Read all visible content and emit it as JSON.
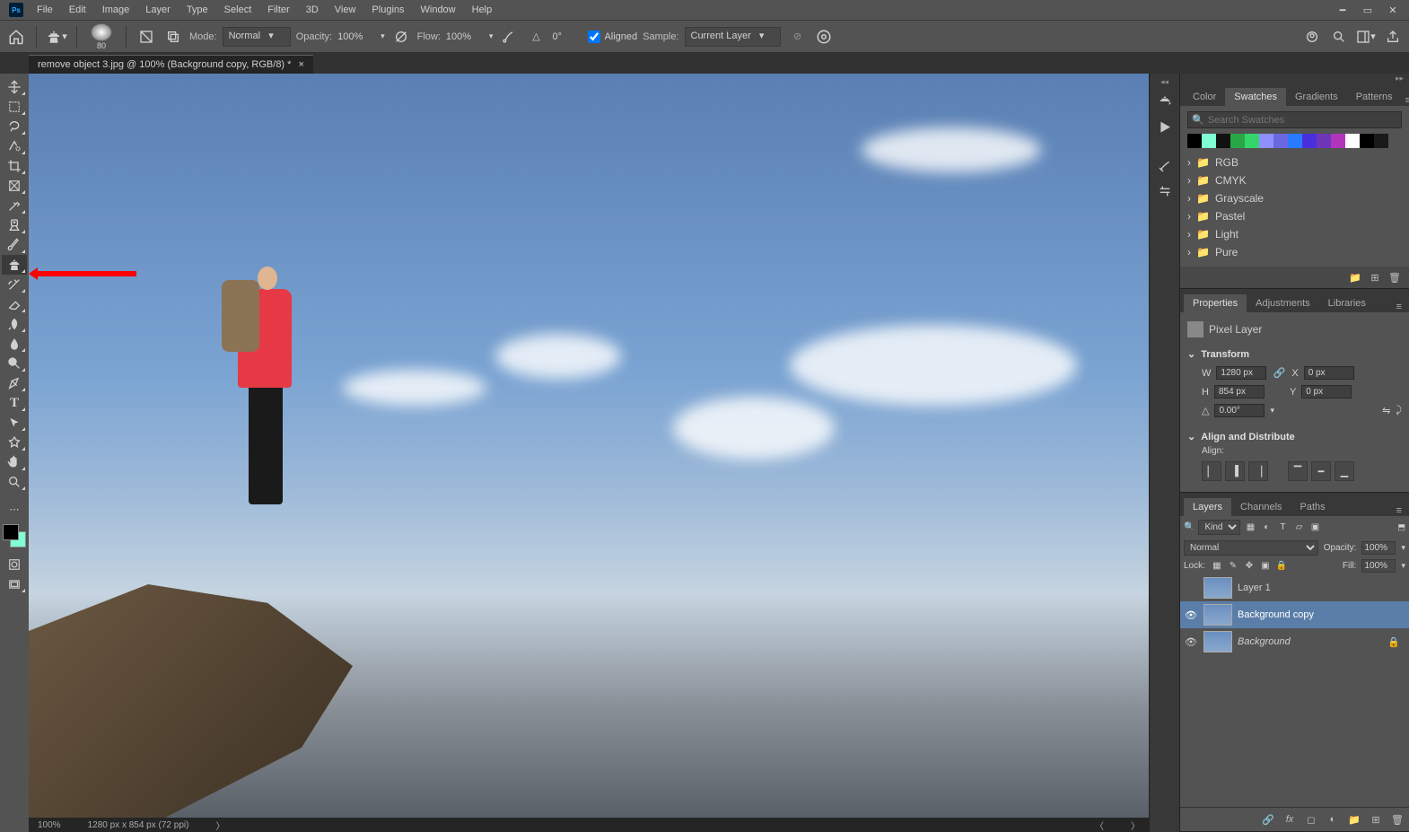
{
  "menu": {
    "items": [
      "File",
      "Edit",
      "Image",
      "Layer",
      "Type",
      "Select",
      "Filter",
      "3D",
      "View",
      "Plugins",
      "Window",
      "Help"
    ]
  },
  "options": {
    "brush_size": "80",
    "mode_label": "Mode:",
    "mode_value": "Normal",
    "opacity_label": "Opacity:",
    "opacity_value": "100%",
    "flow_label": "Flow:",
    "flow_value": "100%",
    "angle_value": "0°",
    "aligned_label": "Aligned",
    "sample_label": "Sample:",
    "sample_value": "Current Layer"
  },
  "doc": {
    "title": "remove object 3.jpg @ 100% (Background copy, RGB/8) *"
  },
  "swatches": {
    "tabs": [
      "Color",
      "Swatches",
      "Gradients",
      "Patterns"
    ],
    "active_tab": 1,
    "search_placeholder": "Search Swatches",
    "colors_row": [
      "#000000",
      "#7fffd4",
      "#111111",
      "#2aa745",
      "#35d56a",
      "#8f8fff",
      "#6a68e0",
      "#2a7aff",
      "#4a2fdf",
      "#6e36b8",
      "#b035bb",
      "#ffffff",
      "#000000",
      "#1a1a1a"
    ],
    "folders": [
      "RGB",
      "CMYK",
      "Grayscale",
      "Pastel",
      "Light",
      "Pure"
    ]
  },
  "properties": {
    "tabs": [
      "Properties",
      "Adjustments",
      "Libraries"
    ],
    "active_tab": 0,
    "layer_type": "Pixel Layer",
    "transform_label": "Transform",
    "w_label": "W",
    "w_value": "1280 px",
    "h_label": "H",
    "h_value": "854 px",
    "x_label": "X",
    "x_value": "0 px",
    "y_label": "Y",
    "y_value": "0 px",
    "angle_value": "0.00°",
    "align_section": "Align and Distribute",
    "align_label": "Align:"
  },
  "layers": {
    "tabs": [
      "Layers",
      "Channels",
      "Paths"
    ],
    "active_tab": 0,
    "kind_label": "Kind",
    "blend_mode": "Normal",
    "opacity_label": "Opacity:",
    "opacity_value": "100%",
    "lock_label": "Lock:",
    "fill_label": "Fill:",
    "fill_value": "100%",
    "items": [
      {
        "name": "Layer 1",
        "visible": false,
        "locked": false,
        "italic": false
      },
      {
        "name": "Background copy",
        "visible": true,
        "locked": false,
        "italic": false,
        "selected": true
      },
      {
        "name": "Background",
        "visible": true,
        "locked": true,
        "italic": true
      }
    ]
  },
  "status": {
    "zoom": "100%",
    "doc_info": "1280 px x 854 px (72 ppi)"
  },
  "foreground_color": "#000000",
  "background_color": "#7fffd4"
}
